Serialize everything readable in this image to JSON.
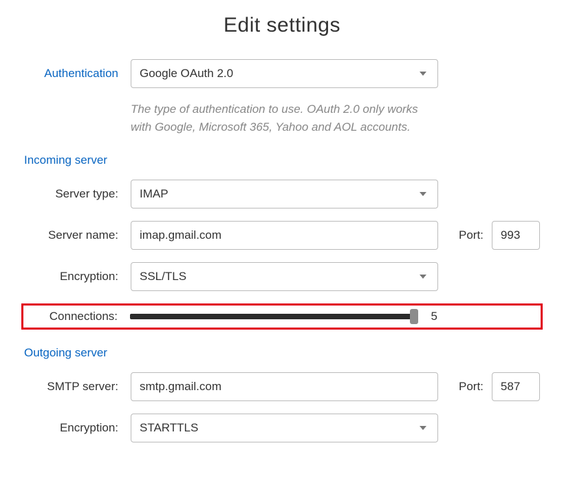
{
  "title": "Edit settings",
  "authentication": {
    "label": "Authentication",
    "value": "Google OAuth 2.0",
    "description": "The type of authentication to use. OAuth 2.0 only works with Google, Microsoft 365, Yahoo and AOL accounts."
  },
  "incoming": {
    "section_label": "Incoming server",
    "server_type": {
      "label": "Server type:",
      "value": "IMAP"
    },
    "server_name": {
      "label": "Server name:",
      "value": "imap.gmail.com"
    },
    "port": {
      "label": "Port:",
      "value": "993"
    },
    "encryption": {
      "label": "Encryption:",
      "value": "SSL/TLS"
    },
    "connections": {
      "label": "Connections:",
      "value": "5"
    }
  },
  "outgoing": {
    "section_label": "Outgoing server",
    "smtp_server": {
      "label": "SMTP server:",
      "value": "smtp.gmail.com"
    },
    "port": {
      "label": "Port:",
      "value": "587"
    },
    "encryption": {
      "label": "Encryption:",
      "value": "STARTTLS"
    }
  }
}
